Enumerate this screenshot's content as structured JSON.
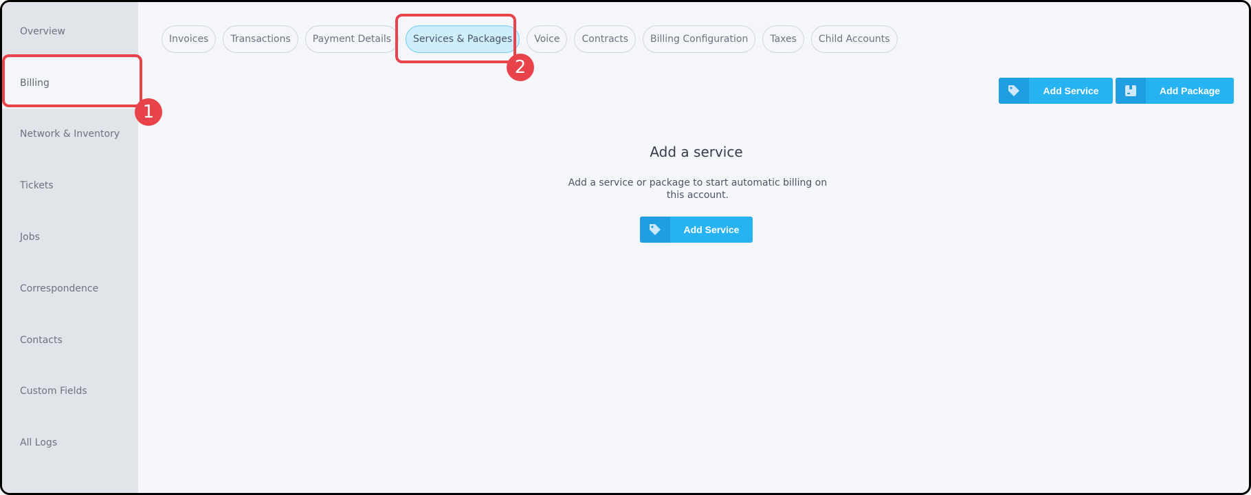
{
  "sidebar": {
    "items": [
      {
        "label": "Overview"
      },
      {
        "label": "Billing"
      },
      {
        "label": "Network & Inventory"
      },
      {
        "label": "Tickets"
      },
      {
        "label": "Jobs"
      },
      {
        "label": "Correspondence"
      },
      {
        "label": "Contacts"
      },
      {
        "label": "Custom Fields"
      },
      {
        "label": "All Logs"
      }
    ],
    "active": "Billing"
  },
  "tabs": [
    {
      "label": "Invoices"
    },
    {
      "label": "Transactions"
    },
    {
      "label": "Payment Details"
    },
    {
      "label": "Services & Packages"
    },
    {
      "label": "Voice"
    },
    {
      "label": "Contracts"
    },
    {
      "label": "Billing Configuration"
    },
    {
      "label": "Taxes"
    },
    {
      "label": "Child Accounts"
    }
  ],
  "active_tab": "Services & Packages",
  "toolbar": {
    "add_service_label": "Add Service",
    "add_package_label": "Add Package"
  },
  "empty_state": {
    "title": "Add a service",
    "message": "Add a service or package to start automatic billing on this account.",
    "button_label": "Add Service"
  },
  "annotations": {
    "step1": "1",
    "step2": "2"
  },
  "colors": {
    "accent": "#27b2f1",
    "accent_dark": "#1f9ee1",
    "annotation": "#e8434b"
  }
}
